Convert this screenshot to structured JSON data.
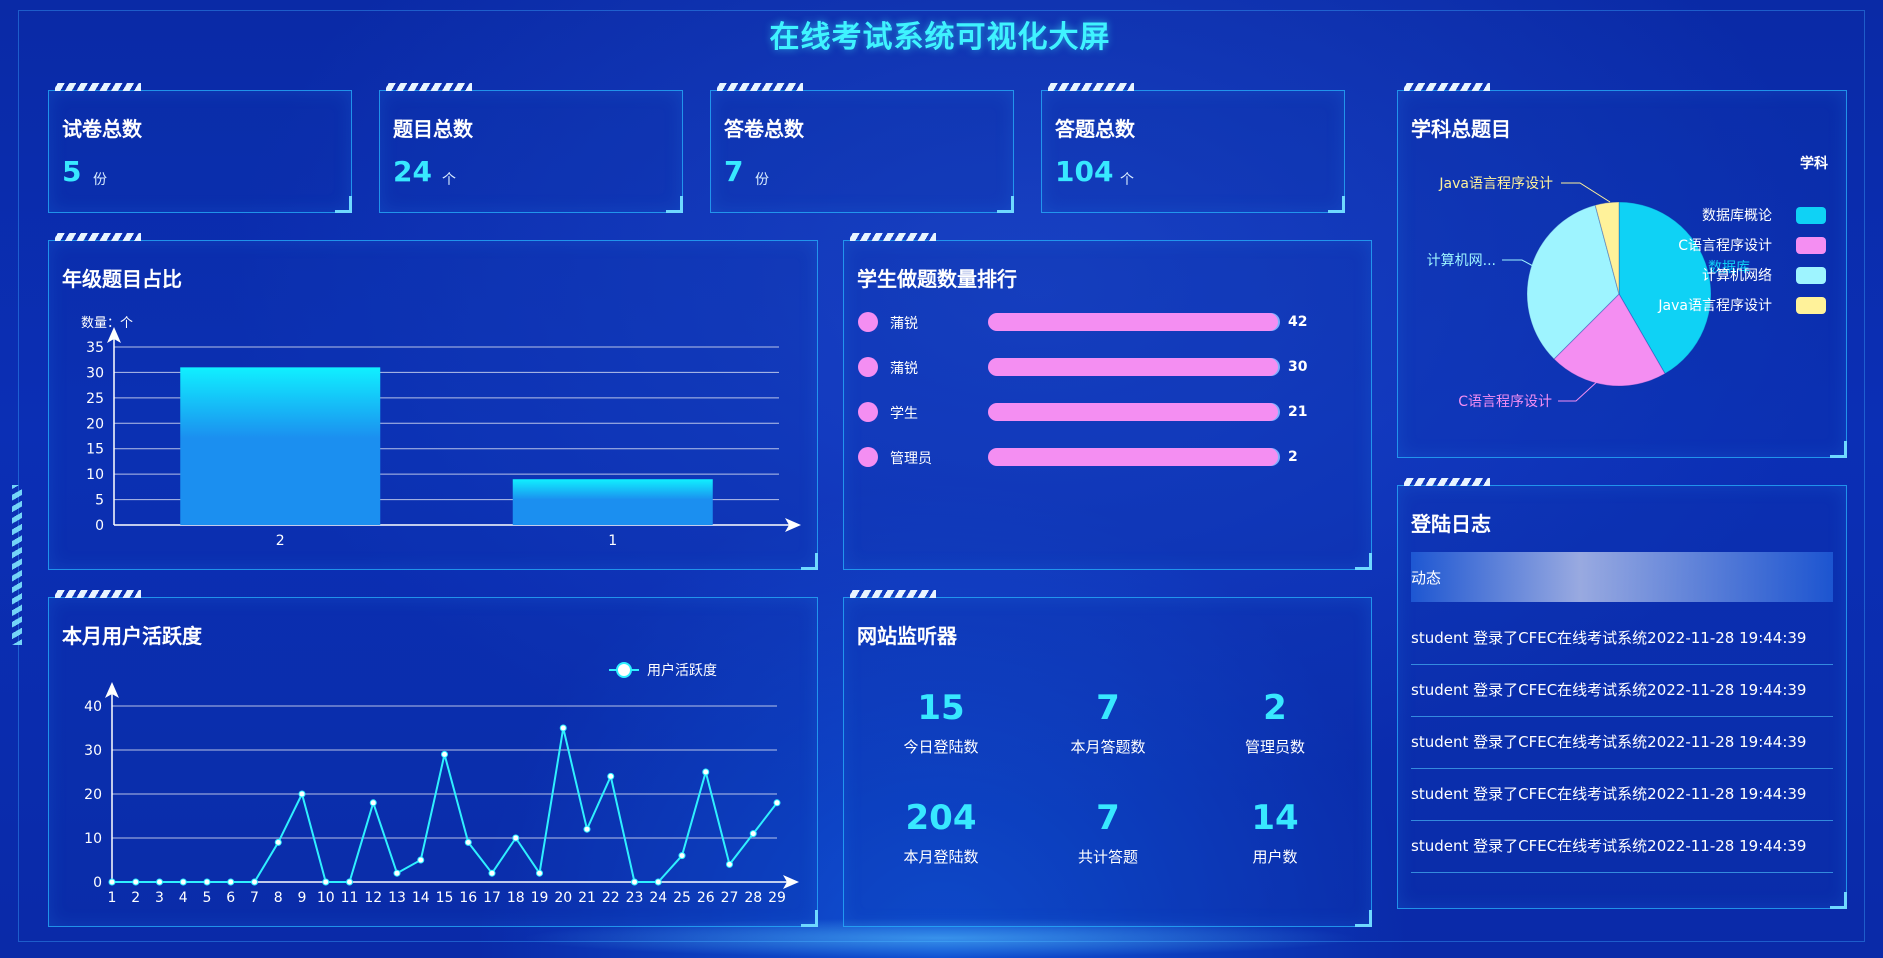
{
  "page_title": "在线考试系统可视化大屏",
  "colors": {
    "accent_cyan": "#38e8ff",
    "pink": "#f48ef2",
    "bar_top": "#10f0ff",
    "bar_bottom": "#1b8ff0"
  },
  "stats": [
    {
      "label": "试卷总数",
      "value": "5",
      "unit": "份"
    },
    {
      "label": "题目总数",
      "value": "24",
      "unit": "个"
    },
    {
      "label": "答卷总数",
      "value": "7",
      "unit": "份"
    },
    {
      "label": "答题总数",
      "value": "104",
      "unit": "个"
    }
  ],
  "grade_panel": {
    "title": "年级题目占比",
    "ylabel": "数量：个"
  },
  "ranking": {
    "title": "学生做题数量排行",
    "items": [
      {
        "name": "蒲锐",
        "value": "42"
      },
      {
        "name": "蒲锐",
        "value": "30"
      },
      {
        "name": "学生",
        "value": "21"
      },
      {
        "name": "管理员",
        "value": "2"
      }
    ]
  },
  "subject_panel": {
    "title": "学科总题目"
  },
  "activity_panel": {
    "title": "本月用户活跃度"
  },
  "monitor": {
    "title": "网站监听器",
    "items": [
      {
        "value": "15",
        "label": "今日登陆数"
      },
      {
        "value": "7",
        "label": "本月答题数"
      },
      {
        "value": "2",
        "label": "管理员数"
      },
      {
        "value": "204",
        "label": "本月登陆数"
      },
      {
        "value": "7",
        "label": "共计答题"
      },
      {
        "value": "14",
        "label": "用户数"
      }
    ]
  },
  "login_log": {
    "title": "登陆日志",
    "header": "动态",
    "rows": [
      "student 登录了CFEC在线考试系统2022-11-28 19:44:39",
      "student 登录了CFEC在线考试系统2022-11-28 19:44:39",
      "student 登录了CFEC在线考试系统2022-11-28 19:44:39",
      "student 登录了CFEC在线考试系统2022-11-28 19:44:39",
      "student 登录了CFEC在线考试系统2022-11-28 19:44:39"
    ]
  },
  "chart_data": [
    {
      "type": "bar",
      "categories": [
        "2",
        "1"
      ],
      "values": [
        31,
        9
      ],
      "title": "年级题目占比",
      "ylabel": "数量：个",
      "ylim": [
        0,
        35
      ],
      "yticks": [
        0,
        5,
        10,
        15,
        20,
        25,
        30,
        35
      ],
      "grid": true
    },
    {
      "type": "pie",
      "legend_title": "学科",
      "legend_placement": "right",
      "slices": [
        {
          "name": "数据库概论",
          "value": 10,
          "color": "#0fd2f5"
        },
        {
          "name": "C语言程序设计",
          "value": 5,
          "color": "#f48ef2"
        },
        {
          "name": "计算机网络",
          "value": 8,
          "color": "#9ef4ff"
        },
        {
          "name": "Java语言程序设计",
          "value": 1,
          "color": "#fff29a"
        }
      ],
      "callout_labels": [
        "Java语言程序设计",
        "计算机网...",
        "C语言程序设计",
        "数据库"
      ]
    },
    {
      "type": "line",
      "title": "本月用户活跃度",
      "series": [
        {
          "name": "用户活跃度",
          "values": [
            0,
            0,
            0,
            0,
            0,
            0,
            0,
            9,
            20,
            0,
            0,
            18,
            2,
            5,
            29,
            9,
            2,
            10,
            2,
            35,
            12,
            24,
            0,
            0,
            6,
            25,
            4,
            11,
            18
          ]
        }
      ],
      "x": [
        "1",
        "2",
        "3",
        "4",
        "5",
        "6",
        "7",
        "8",
        "9",
        "10",
        "11",
        "12",
        "13",
        "14",
        "15",
        "16",
        "17",
        "18",
        "19",
        "20",
        "21",
        "22",
        "23",
        "24",
        "25",
        "26",
        "27",
        "28",
        "29"
      ],
      "ylim": [
        0,
        40
      ],
      "yticks": [
        0,
        10,
        20,
        30,
        40
      ],
      "legend_placement": "top-right",
      "grid": true
    }
  ]
}
